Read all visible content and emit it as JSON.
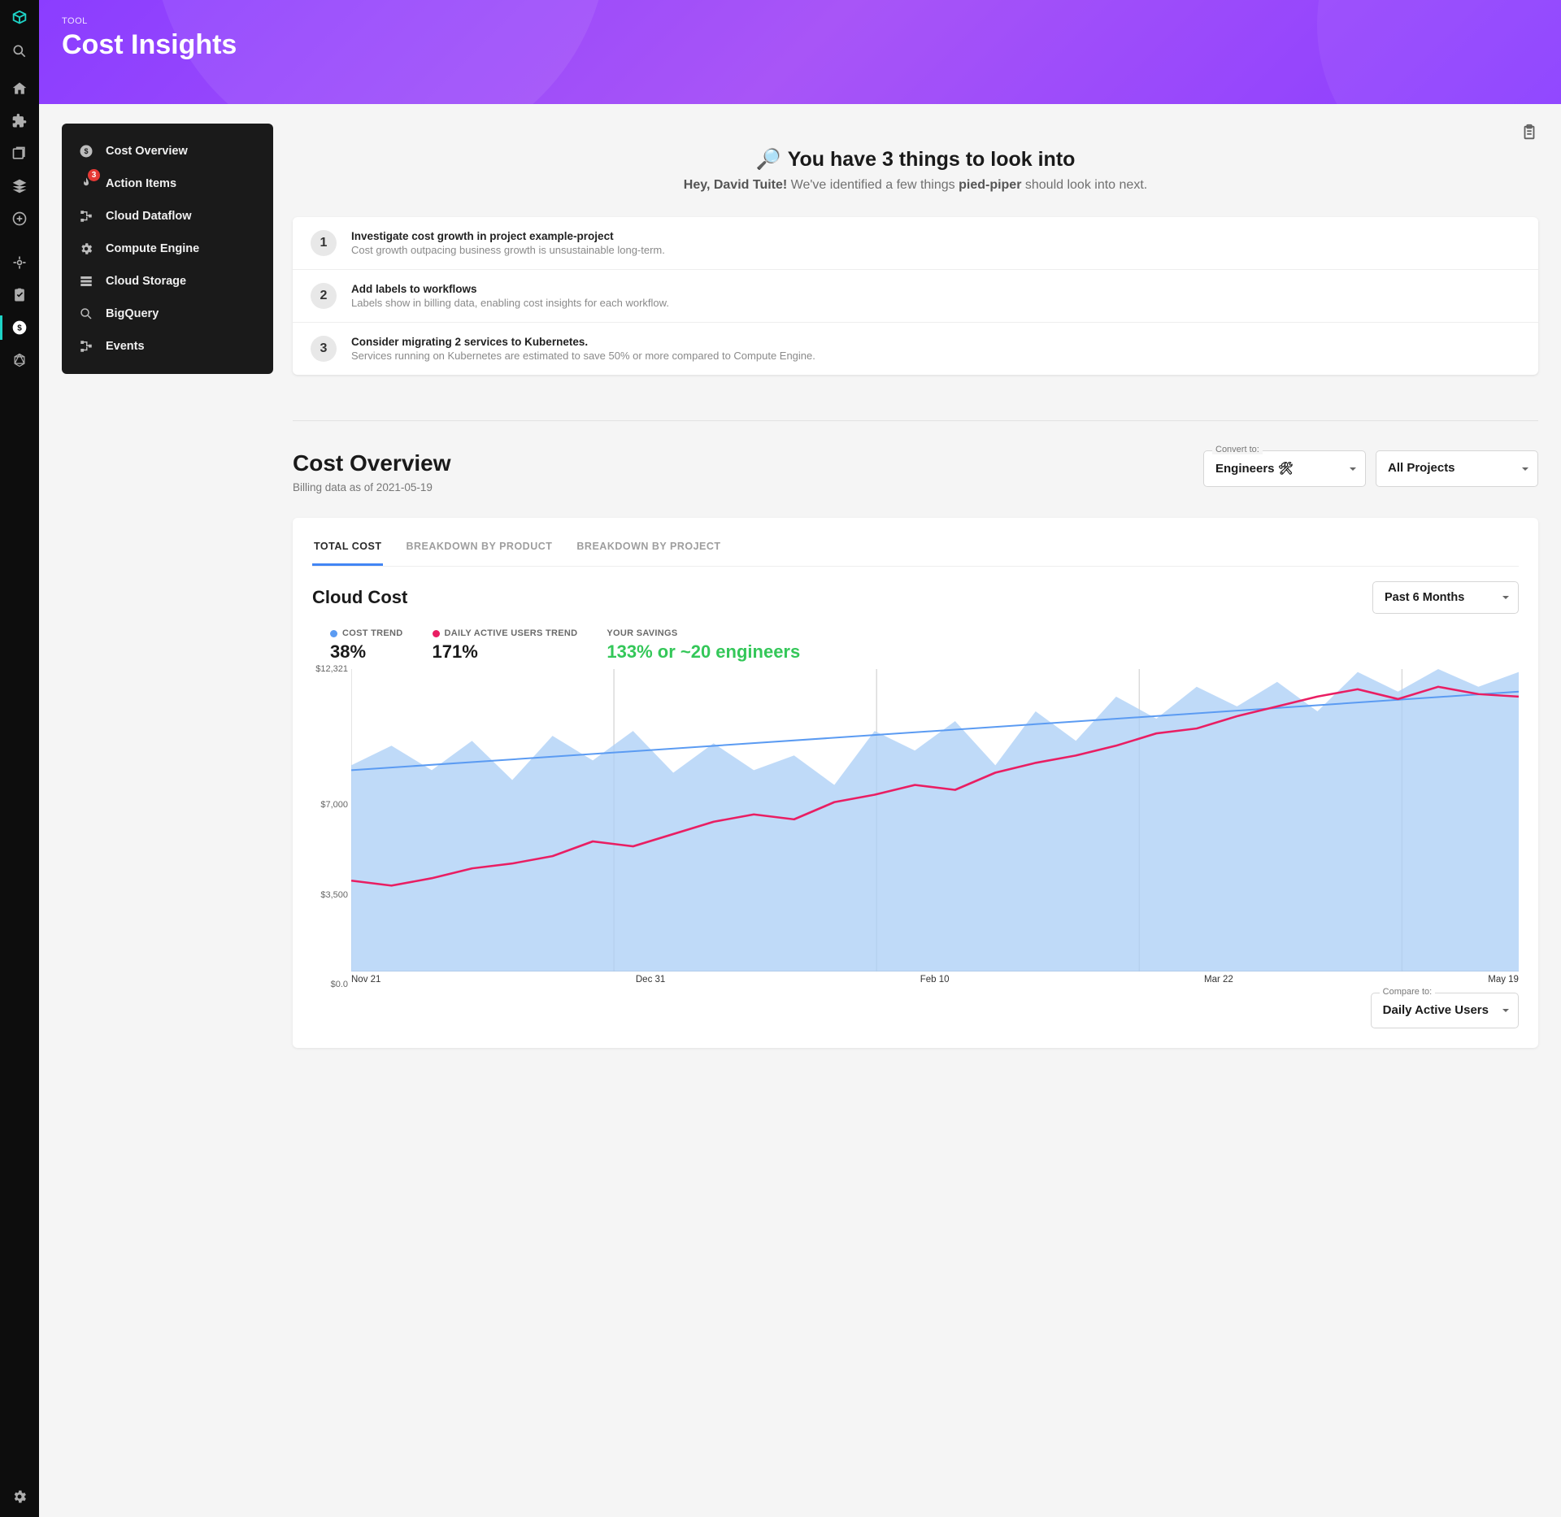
{
  "header": {
    "eyebrow": "TOOL",
    "title": "Cost Insights"
  },
  "sidebar": {
    "items": [
      {
        "label": "Cost Overview"
      },
      {
        "label": "Action Items",
        "badge": "3"
      },
      {
        "label": "Cloud Dataflow"
      },
      {
        "label": "Compute Engine"
      },
      {
        "label": "Cloud Storage"
      },
      {
        "label": "BigQuery"
      },
      {
        "label": "Events"
      }
    ]
  },
  "alerts": {
    "icon": "🔎",
    "heading": "You have 3 things to look into",
    "greeting_b1": "Hey, David Tuite!",
    "greeting_mid": " We've identified a few things ",
    "greeting_b2": "pied-piper",
    "greeting_end": " should look into next.",
    "items": [
      {
        "n": "1",
        "title": "Investigate cost growth in project example-project",
        "desc": "Cost growth outpacing business growth is unsustainable long-term."
      },
      {
        "n": "2",
        "title": "Add labels to workflows",
        "desc": "Labels show in billing data, enabling cost insights for each workflow."
      },
      {
        "n": "3",
        "title": "Consider migrating 2 services to Kubernetes.",
        "desc": "Services running on Kubernetes are estimated to save 50% or more compared to Compute Engine."
      }
    ]
  },
  "overview": {
    "title": "Cost Overview",
    "subtitle": "Billing data as of 2021-05-19",
    "convert_label": "Convert to:",
    "convert_value": "Engineers 🛠",
    "project_value": "All Projects"
  },
  "chart": {
    "tabs": [
      {
        "label": "TOTAL COST",
        "active": true
      },
      {
        "label": "BREAKDOWN BY PRODUCT"
      },
      {
        "label": "BREAKDOWN BY PROJECT"
      }
    ],
    "title": "Cloud Cost",
    "period_value": "Past 6 Months",
    "legend": {
      "cost_trend": {
        "label": "COST TREND",
        "value": "38%",
        "color": "#5b9bf2"
      },
      "dau_trend": {
        "label": "DAILY ACTIVE USERS TREND",
        "value": "171%",
        "color": "#e91e63"
      },
      "savings": {
        "label": "YOUR SAVINGS",
        "value": "133% or ~20 engineers"
      }
    },
    "compare_label": "Compare to:",
    "compare_value": "Daily Active Users"
  },
  "chart_data": {
    "type": "line",
    "xlabel": "",
    "ylabel": "",
    "ylim": [
      0,
      12321
    ],
    "y_ticks": [
      "$12,321",
      "$7,000",
      "$3,500",
      "$0.0"
    ],
    "x_ticks": [
      "Nov 21",
      "Dec 31",
      "Feb 10",
      "Mar 22",
      "May 19"
    ],
    "series": [
      {
        "name": "Cloud Cost (area)",
        "type": "area",
        "color": "#a9cef6",
        "values": [
          8400,
          9200,
          8200,
          9400,
          7800,
          9600,
          8600,
          9800,
          8100,
          9300,
          8200,
          8800,
          7600,
          9800,
          9000,
          10200,
          8400,
          10600,
          9400,
          11200,
          10300,
          11600,
          10800,
          11800,
          10600,
          12200,
          11400,
          12321,
          11600,
          12200
        ]
      },
      {
        "name": "Cost Trend",
        "type": "line",
        "color": "#5b9bf2",
        "values_start": 8200,
        "values_end": 11400
      },
      {
        "name": "Daily Active Users Trend",
        "type": "line",
        "color": "#e91e63",
        "values": [
          3700,
          3500,
          3800,
          4200,
          4400,
          4700,
          5300,
          5100,
          5600,
          6100,
          6400,
          6200,
          6900,
          7200,
          7600,
          7400,
          8100,
          8500,
          8800,
          9200,
          9700,
          9900,
          10400,
          10800,
          11200,
          11500,
          11100,
          11600,
          11300,
          11200
        ]
      }
    ]
  }
}
